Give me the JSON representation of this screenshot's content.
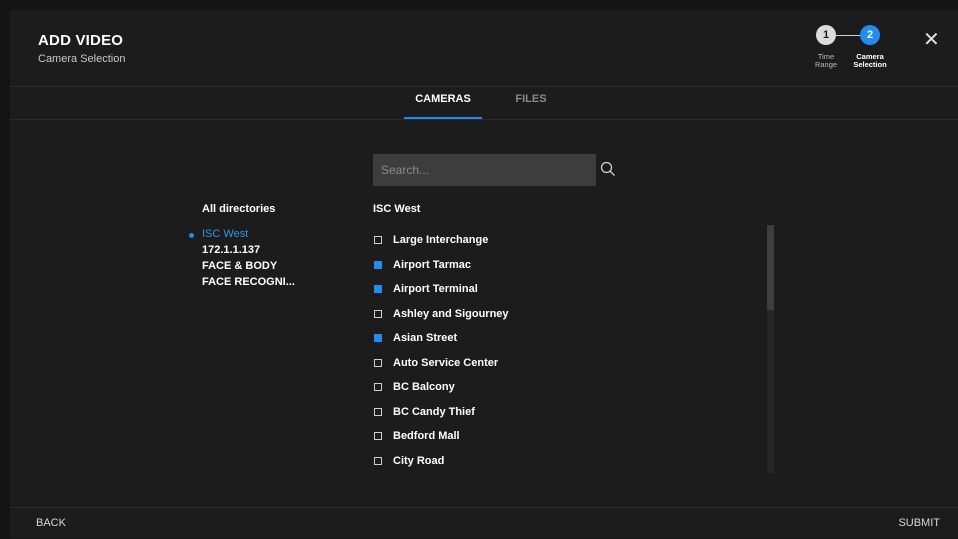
{
  "header": {
    "title": "ADD VIDEO",
    "subtitle": "Camera Selection",
    "steps": [
      {
        "number": "1",
        "label_line1": "Time",
        "label_line2": "Range"
      },
      {
        "number": "2",
        "label_line1": "Camera",
        "label_line2": "Selection"
      }
    ],
    "close_icon": "close-icon"
  },
  "tabs": [
    {
      "label": "CAMERAS",
      "active": true
    },
    {
      "label": "FILES",
      "active": false
    }
  ],
  "search": {
    "placeholder": "Search...",
    "value": "",
    "icon": "search-icon"
  },
  "directories": {
    "heading": "All directories",
    "items": [
      "ISC West",
      "172.1.1.137",
      "FACE & BODY",
      "FACE RECOGNI..."
    ],
    "selected": "ISC West"
  },
  "cameras": {
    "heading": "ISC West",
    "items": [
      {
        "label": "Large Interchange",
        "checked": false
      },
      {
        "label": "Airport Tarmac",
        "checked": true
      },
      {
        "label": "Airport Terminal",
        "checked": true
      },
      {
        "label": "Ashley and Sigourney",
        "checked": false
      },
      {
        "label": "Asian Street",
        "checked": true
      },
      {
        "label": "Auto Service Center",
        "checked": false
      },
      {
        "label": "BC Balcony",
        "checked": false
      },
      {
        "label": "BC Candy Thief",
        "checked": false
      },
      {
        "label": "Bedford Mall",
        "checked": false
      },
      {
        "label": "City Road",
        "checked": false
      }
    ]
  },
  "footer": {
    "back_label": "BACK",
    "submit_label": "SUBMIT"
  },
  "colors": {
    "accent": "#1e8cf0",
    "background": "#1c1c1c",
    "search_bg": "#3d3d3d"
  }
}
